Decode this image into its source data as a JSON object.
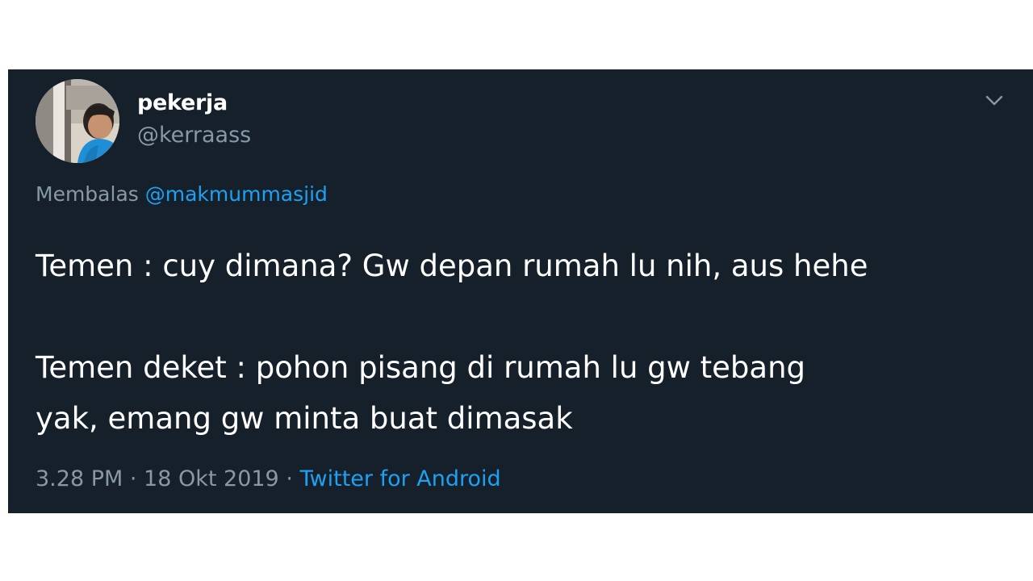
{
  "tweet": {
    "author": {
      "display_name": "pekerja",
      "handle": "@kerraass"
    },
    "reply_prefix": "Membalas",
    "reply_to": "@makmummasjid",
    "text_lines": [
      "Temen : cuy dimana? Gw depan rumah lu nih, aus hehe",
      "",
      "Temen deket : pohon pisang di rumah lu gw tebang",
      "yak, emang gw minta buat dimasak"
    ],
    "time": "3.28 PM",
    "separator": " · ",
    "date": "18 Okt 2019",
    "source": "Twitter for Android",
    "menu_icon": "chevron-down-icon"
  },
  "colors": {
    "page_background": "#ffffff",
    "card_background": "#15202b",
    "primary_text": "#ffffff",
    "secondary_text": "#8899a6",
    "accent": "#1da1f2"
  }
}
